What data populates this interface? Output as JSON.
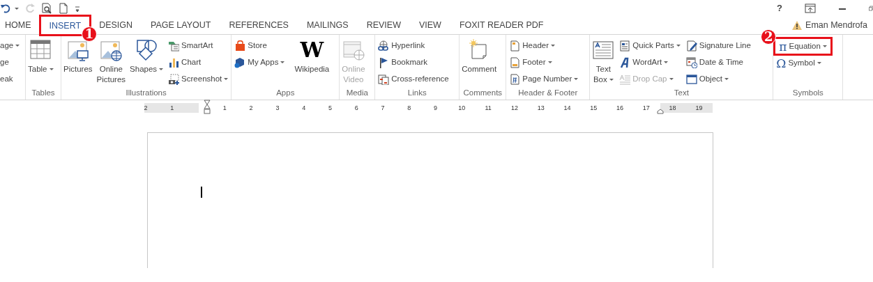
{
  "quick_access": [
    {
      "dropdown": true,
      "disabled": false
    },
    {
      "dropdown": false,
      "disabled": true
    },
    {
      "dropdown": false,
      "disabled": false
    },
    {
      "dropdown": false,
      "disabled": false
    }
  ],
  "help": "?",
  "tabs": [
    {
      "label": "HOME",
      "selected": false
    },
    {
      "label": "INSERT",
      "selected": true,
      "annotation": "1"
    },
    {
      "label": "DESIGN",
      "selected": false
    },
    {
      "label": "PAGE LAYOUT",
      "selected": false
    },
    {
      "label": "REFERENCES",
      "selected": false
    },
    {
      "label": "MAILINGS",
      "selected": false
    },
    {
      "label": "REVIEW",
      "selected": false
    },
    {
      "label": "VIEW",
      "selected": false
    },
    {
      "label": "FOXIT READER PDF",
      "selected": false
    }
  ],
  "account": {
    "name": "Eman Mendrofa"
  },
  "ribbon_groups": [
    {
      "columns": [
        {
          "kind": "stack",
          "items": [
            {
              "label": "age",
              "dropdown": true,
              "disabled": false
            },
            {
              "label": "ge",
              "dropdown": false,
              "disabled": false
            },
            {
              "label": "eak",
              "dropdown": false,
              "disabled": false
            }
          ]
        }
      ]
    },
    {
      "label": "Tables",
      "columns": [
        {
          "kind": "large",
          "items": [
            {
              "label": "Table",
              "dropdown": true,
              "disabled": false
            }
          ]
        }
      ]
    },
    {
      "label": "Illustrations",
      "columns": [
        {
          "kind": "large",
          "items": [
            {
              "label": "Pictures",
              "dropdown": false,
              "disabled": false
            }
          ]
        },
        {
          "kind": "large",
          "items": [
            {
              "label": "Online Pictures",
              "dropdown": false,
              "disabled": false
            }
          ]
        },
        {
          "kind": "large",
          "items": [
            {
              "label": "Shapes",
              "dropdown": true,
              "disabled": false
            }
          ]
        },
        {
          "kind": "stack",
          "items": [
            {
              "label": "SmartArt",
              "dropdown": false,
              "disabled": false
            },
            {
              "label": "Chart",
              "dropdown": false,
              "disabled": false
            },
            {
              "label": "Screenshot",
              "dropdown": true,
              "disabled": false
            }
          ]
        }
      ]
    },
    {
      "label": "Apps",
      "columns": [
        {
          "kind": "stack",
          "items": [
            {
              "label": "Store",
              "dropdown": false,
              "disabled": false
            },
            {
              "label": "My Apps",
              "dropdown": true,
              "disabled": false
            }
          ]
        },
        {
          "kind": "large",
          "items": [
            {
              "label": "Wikipedia",
              "glyph": "W",
              "dropdown": false,
              "disabled": false
            }
          ]
        }
      ]
    },
    {
      "label": "Media",
      "columns": [
        {
          "kind": "large",
          "items": [
            {
              "label": "Online Video",
              "dropdown": false,
              "disabled": true
            }
          ]
        }
      ]
    },
    {
      "label": "Links",
      "columns": [
        {
          "kind": "stack",
          "items": [
            {
              "label": "Hyperlink",
              "dropdown": false,
              "disabled": false
            },
            {
              "label": "Bookmark",
              "dropdown": false,
              "disabled": false
            },
            {
              "label": "Cross-reference",
              "dropdown": false,
              "disabled": false
            }
          ]
        }
      ]
    },
    {
      "label": "Comments",
      "columns": [
        {
          "kind": "large",
          "items": [
            {
              "label": "Comment",
              "dropdown": false,
              "disabled": false
            }
          ]
        }
      ]
    },
    {
      "label": "Header & Footer",
      "columns": [
        {
          "kind": "stack",
          "items": [
            {
              "label": "Header",
              "dropdown": true,
              "disabled": false
            },
            {
              "label": "Footer",
              "dropdown": true,
              "disabled": false
            },
            {
              "label": "Page Number",
              "dropdown": true,
              "disabled": false
            }
          ]
        }
      ]
    },
    {
      "label": "Text",
      "columns": [
        {
          "kind": "large",
          "items": [
            {
              "label": "Text Box",
              "dropdown": true,
              "disabled": false
            }
          ]
        },
        {
          "kind": "stack",
          "items": [
            {
              "label": "Quick Parts",
              "dropdown": true,
              "disabled": false
            },
            {
              "label": "WordArt",
              "dropdown": true,
              "disabled": false
            },
            {
              "label": "Drop Cap",
              "dropdown": true,
              "disabled": true
            }
          ]
        },
        {
          "kind": "stack",
          "items": [
            {
              "label": "Signature Line",
              "dropdown": false,
              "disabled": false
            },
            {
              "label": "Date & Time",
              "dropdown": false,
              "disabled": false
            },
            {
              "label": "Object",
              "dropdown": true,
              "disabled": false
            }
          ]
        }
      ]
    },
    {
      "label": "Symbols",
      "columns": [
        {
          "kind": "stack",
          "items": [
            {
              "label": "Equation",
              "glyph": "π",
              "dropdown": true,
              "disabled": false,
              "annotation": "2"
            },
            {
              "label": "Symbol",
              "glyph": "Ω",
              "dropdown": true,
              "disabled": false
            }
          ]
        }
      ]
    }
  ],
  "ruler": {
    "left_numbers": [
      "2",
      "1"
    ],
    "right_numbers": [
      "1",
      "2",
      "3",
      "4",
      "5",
      "6",
      "7",
      "8",
      "9",
      "10",
      "11",
      "12",
      "13",
      "14",
      "15",
      "16",
      "17",
      "18",
      "19"
    ]
  }
}
